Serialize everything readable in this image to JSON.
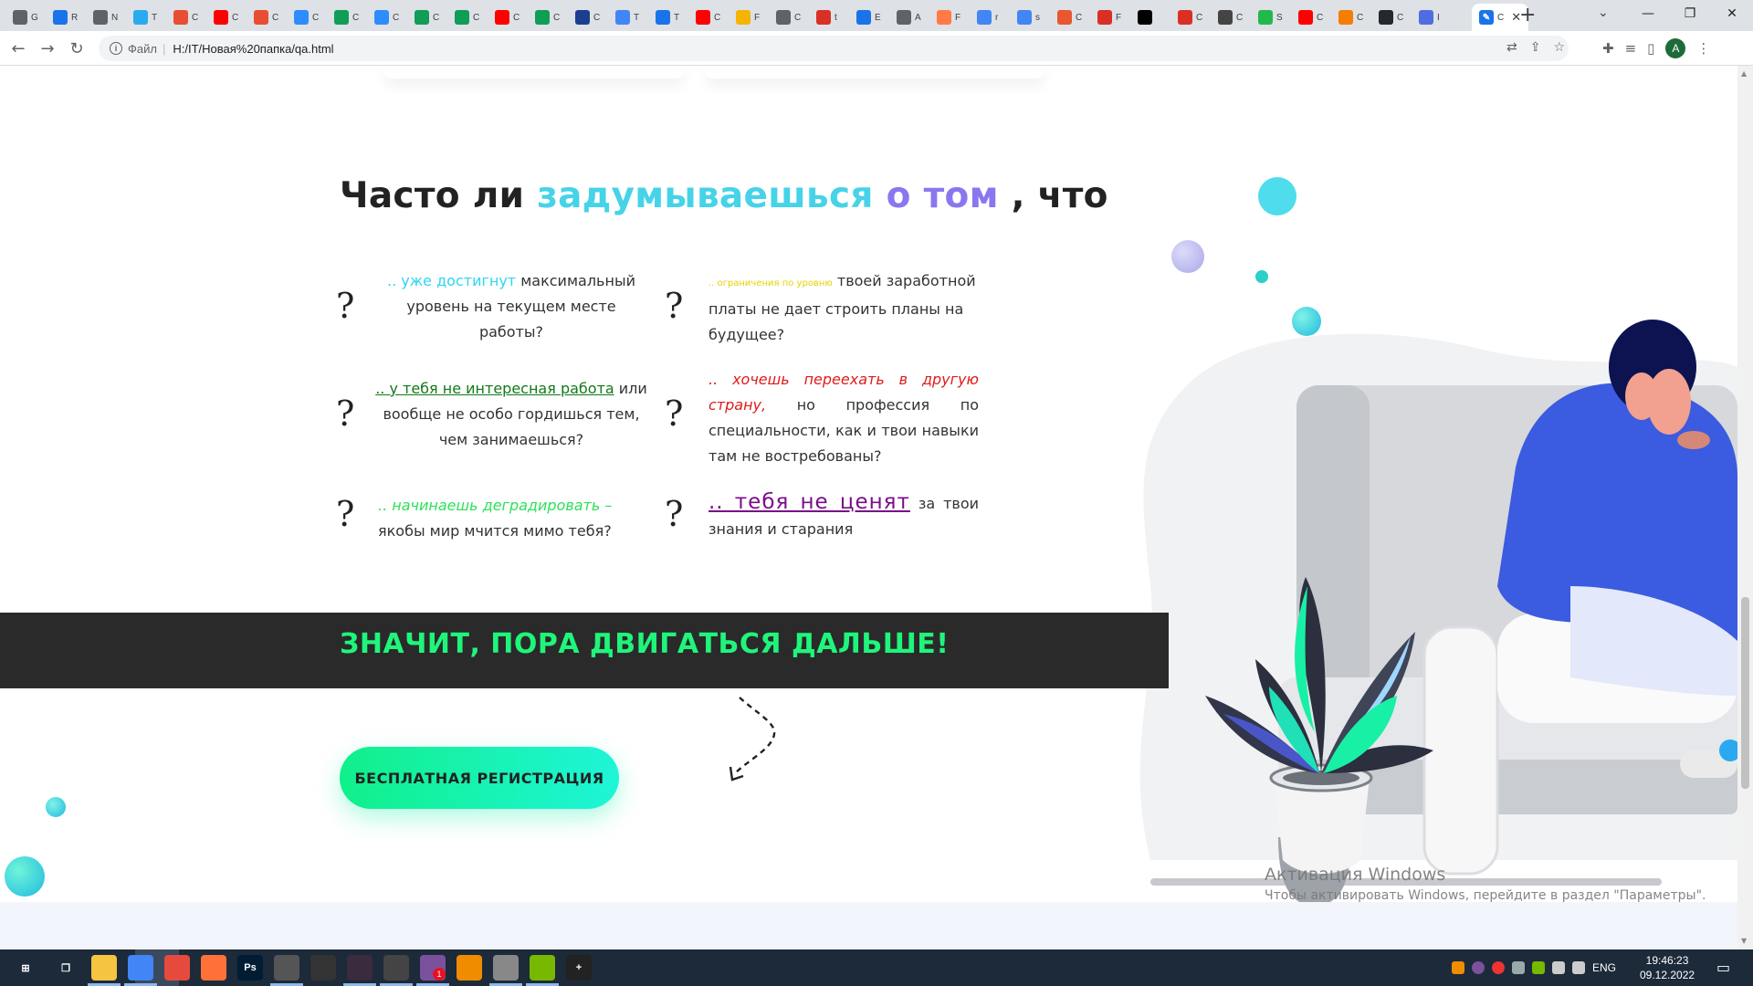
{
  "browser": {
    "tabs": [
      {
        "icon": "chrome-icon",
        "color": "#5f6368",
        "char": "G"
      },
      {
        "icon": "app-r-icon",
        "color": "#1a73e8",
        "char": "R"
      },
      {
        "icon": "chrome-icon",
        "color": "#5f6368",
        "char": "N"
      },
      {
        "icon": "telegram-icon",
        "color": "#2aabee",
        "char": "T"
      },
      {
        "icon": "git-icon",
        "color": "#e84e31",
        "char": "C"
      },
      {
        "icon": "youtube-icon",
        "color": "#ff0000",
        "char": "C"
      },
      {
        "icon": "git-icon",
        "color": "#e84e31",
        "char": "C"
      },
      {
        "icon": "zoom-icon",
        "color": "#2d8cff",
        "char": "C"
      },
      {
        "icon": "sheets-icon",
        "color": "#0f9d58",
        "char": "C"
      },
      {
        "icon": "zoom-icon",
        "color": "#2d8cff",
        "char": "C"
      },
      {
        "icon": "sheets-icon",
        "color": "#0f9d58",
        "char": "C"
      },
      {
        "icon": "sheets-icon",
        "color": "#0f9d58",
        "char": "C"
      },
      {
        "icon": "youtube-icon",
        "color": "#ff0000",
        "char": "C"
      },
      {
        "icon": "sheets-icon",
        "color": "#0f9d58",
        "char": "C"
      },
      {
        "icon": "grid-icon",
        "color": "#1a3f8f",
        "char": "C"
      },
      {
        "icon": "maps-icon",
        "color": "#4285f4",
        "char": "T"
      },
      {
        "icon": "pen-icon",
        "color": "#1a73e8",
        "char": "T"
      },
      {
        "icon": "youtube-icon",
        "color": "#ff0000",
        "char": "C"
      },
      {
        "icon": "drive-icon",
        "color": "#f4b400",
        "char": "F"
      },
      {
        "icon": "audio-icon",
        "color": "#5f6368",
        "char": "C"
      },
      {
        "icon": "gmail-icon",
        "color": "#d93025",
        "char": "t"
      },
      {
        "icon": "app-a-icon",
        "color": "#1a73e8",
        "char": "E"
      },
      {
        "icon": "chrome-icon",
        "color": "#5f6368",
        "char": "A"
      },
      {
        "icon": "orange-icon",
        "color": "#ff7a45",
        "char": "F"
      },
      {
        "icon": "google-icon",
        "color": "#4285f4",
        "char": "r"
      },
      {
        "icon": "google-icon",
        "color": "#4285f4",
        "char": "s"
      },
      {
        "icon": "gift-icon",
        "color": "#e8572e",
        "char": "C"
      },
      {
        "icon": "xx-icon",
        "color": "#d93025",
        "char": "F"
      },
      {
        "icon": "medium-icon",
        "color": "#000000",
        "char": ""
      },
      {
        "icon": "x-icon",
        "color": "#d93025",
        "char": "C"
      },
      {
        "icon": "wiki-icon",
        "color": "#444444",
        "char": "C"
      },
      {
        "icon": "green-circle-icon",
        "color": "#23b84b",
        "char": "S"
      },
      {
        "icon": "youtube-icon",
        "color": "#ff0000",
        "char": "C"
      },
      {
        "icon": "blogger-icon",
        "color": "#f57d00",
        "char": "C"
      },
      {
        "icon": "github-icon",
        "color": "#24292e",
        "char": "C"
      },
      {
        "icon": "sb-icon",
        "color": "#4f6de0",
        "char": "I"
      }
    ],
    "active_tab": {
      "icon": "pen-icon",
      "char": "C",
      "close": "✕"
    },
    "new_tab": "+",
    "tab_search": "⌄",
    "window_controls": {
      "minimize": "—",
      "maximize": "❐",
      "close": "✕"
    },
    "nav": {
      "back": "←",
      "forward": "→",
      "reload": "↻"
    },
    "address": {
      "info": "i",
      "file_label": "Файл",
      "separator": "|",
      "url": "H:/IT/Новая%20папка/qa.html"
    },
    "avatar_letter": "A"
  },
  "page": {
    "title": {
      "part1": "Часто ли ",
      "part2": "задумываешься",
      "part3": " о том",
      "part4": " , что"
    },
    "questions": [
      {
        "highlight": ".. уже достигнут",
        "text": " максимальный уровень на текущем месте работы?",
        "style": "cyan",
        "align": "center"
      },
      {
        "highlight": ".. ограничения по уровню",
        "text": " твоей заработной платы не дает строить планы на будущее?",
        "style": "yellow",
        "align": "left"
      },
      {
        "highlight": ".. у тебя не интересная работа",
        "text": " или вообще не особо гордишься тем, чем занимаешься?",
        "style": "green-underline",
        "align": "center"
      },
      {
        "highlight": "..  хочешь переехать в другую страну,",
        "text": " но профессия по специальности, как и твои навыки там не востребованы?",
        "style": "red-italic",
        "align": "justify"
      },
      {
        "highlight": ".. начинаешь деградировать –",
        "text": " якобы мир мчится мимо тебя?",
        "style": "lime-italic",
        "align": "center"
      },
      {
        "highlight": "..  тебя  не  ценят",
        "text": " за твои знания и старания",
        "style": "purple-underline",
        "align": "justify"
      }
    ],
    "question_mark": "?",
    "banner": "ЗНАЧИТ, ПОРА ДВИГАТЬСЯ ДАЛЬШЕ!",
    "cta_button": "БЕСПЛАТНАЯ РЕГИСТРАЦИЯ",
    "colors": {
      "accent_cyan": "#46d3e8",
      "accent_purple": "#8a77ef",
      "banner_bg": "#2a2a2a",
      "banner_text": "#1ff57a",
      "button_from": "#10f08a",
      "button_to": "#1ef5d8"
    }
  },
  "overlay": {
    "activation_title": "Активация Windows",
    "activation_text": "Чтобы активировать Windows, перейдите в раздел \"Параметры\"."
  },
  "taskbar": {
    "apps": [
      {
        "name": "windows-start-icon",
        "label": "⊞"
      },
      {
        "name": "task-view-icon",
        "label": "❐"
      },
      {
        "name": "file-explorer-icon",
        "label": ""
      },
      {
        "name": "chrome-icon",
        "label": ""
      },
      {
        "name": "app-red-icon",
        "label": ""
      },
      {
        "name": "firefox-icon",
        "label": ""
      },
      {
        "name": "photoshop-icon",
        "label": "Ps"
      },
      {
        "name": "game-tanks-icon",
        "label": ""
      },
      {
        "name": "game-crest-icon",
        "label": ""
      },
      {
        "name": "game-dark-icon",
        "label": ""
      },
      {
        "name": "game-tanks2-icon",
        "label": ""
      },
      {
        "name": "viber-icon",
        "label": ""
      },
      {
        "name": "vlc-icon",
        "label": ""
      },
      {
        "name": "app-bird-icon",
        "label": ""
      },
      {
        "name": "notepad-plus-icon",
        "label": ""
      },
      {
        "name": "app-plus-icon",
        "label": "+"
      }
    ],
    "viber_badge": "1",
    "lang": "ENG",
    "time": "19:46:23",
    "date": "09.12.2022"
  }
}
